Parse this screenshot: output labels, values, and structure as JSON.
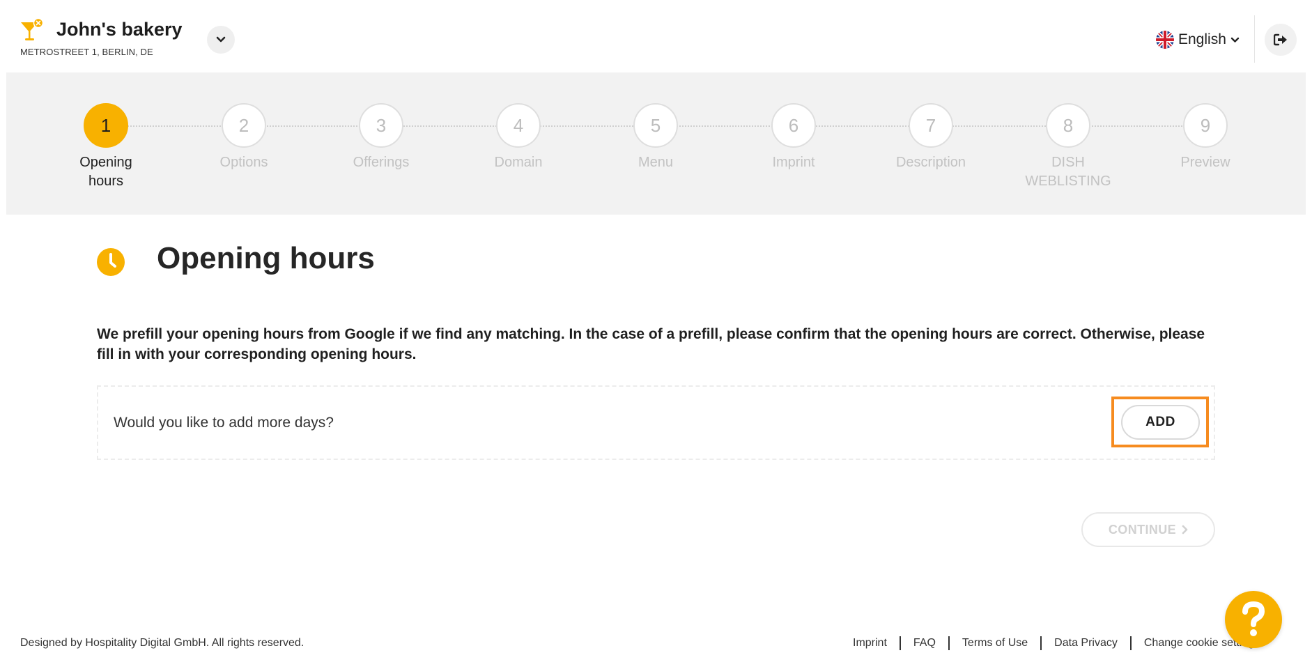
{
  "header": {
    "brand_name": "John's bakery",
    "brand_address": "METROSTREET 1, BERLIN, DE",
    "language": "English",
    "icons": {
      "logo": "cocktail-logo-icon",
      "store_toggle": "chevron-down-icon",
      "language_flag": "uk-flag-icon",
      "language_toggle": "chevron-down-icon",
      "logout": "sign-out-icon"
    }
  },
  "stepper": {
    "active_step": 1,
    "steps": [
      {
        "number": "1",
        "label": "Opening hours"
      },
      {
        "number": "2",
        "label": "Options"
      },
      {
        "number": "3",
        "label": "Offerings"
      },
      {
        "number": "4",
        "label": "Domain"
      },
      {
        "number": "5",
        "label": "Menu"
      },
      {
        "number": "6",
        "label": "Imprint"
      },
      {
        "number": "7",
        "label": "Description"
      },
      {
        "number": "8",
        "label": "DISH WEBLISTING"
      },
      {
        "number": "9",
        "label": "Preview"
      }
    ]
  },
  "main": {
    "title": "Opening hours",
    "title_icon": "clock-icon",
    "intro": "We prefill your opening hours from Google if we find any matching. In the case of a prefill, please confirm that the opening hours are correct. Otherwise, please fill in with your corresponding opening hours.",
    "add_question": "Would you like to add more days?",
    "add_button": "ADD",
    "continue_button": "CONTINUE"
  },
  "footer": {
    "copyright": "Designed by Hospitality Digital GmbH. All rights reserved.",
    "links": [
      "Imprint",
      "FAQ",
      "Terms of Use",
      "Data Privacy",
      "Change cookie settings"
    ],
    "help_icon": "question-mark-icon"
  },
  "colors": {
    "accent": "#f8b100",
    "highlight": "#f68b1f",
    "stepper_bg": "#f2f2f2",
    "inactive": "#c2c2c2"
  }
}
